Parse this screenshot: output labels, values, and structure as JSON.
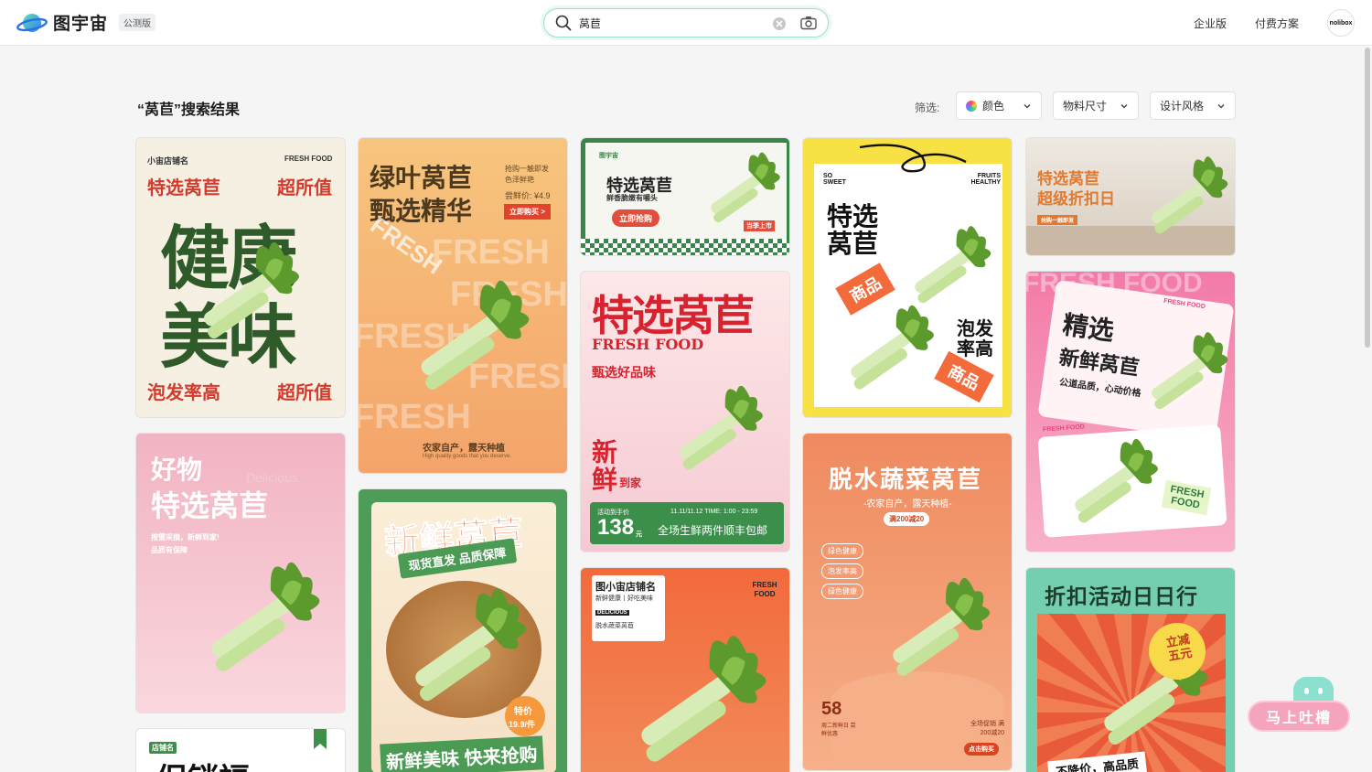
{
  "app": {
    "name": "图宇宙",
    "badge": "公测版"
  },
  "search": {
    "value": "莴苣"
  },
  "nav": {
    "enterprise": "企业版",
    "pricing": "付费方案",
    "avatar_text": "nolibox"
  },
  "results": {
    "title": "“莴苣”搜索结果",
    "filter_label": "筛选:",
    "filters": [
      "颜色",
      "物料尺寸",
      "设计风格"
    ]
  },
  "cards": {
    "c1": {
      "shop": "小宙店铺名",
      "tag": "FRESH FOOD",
      "l1": "特选莴苣",
      "r1": "超所值",
      "big1": "健康",
      "big2": "美味",
      "l2": "泡发率高",
      "r2": "超所值"
    },
    "c2": {
      "title1": "绿叶莴苣",
      "title2": "甄选精华",
      "note1": "抢购一触即发",
      "note2": "色泽鲜艳",
      "price": "尝鲜价: ¥4.9",
      "btn": "立即购买 >",
      "bg": "FRESH",
      "bottom": "农家自产，露天种植",
      "sub": "High quality goods that you deserve."
    },
    "c3": {
      "brand": "图宇宙",
      "title": "特选莴苣",
      "sub": "鲜香脆嫩有嚼头",
      "btn": "立即抢购",
      "tag": "当季上市"
    },
    "c4": {
      "title": "特选莴苣",
      "sub": "FRESH FOOD",
      "tag": "甄选好品味",
      "v1": "新",
      "v2": "鲜",
      "v3": "到家",
      "promo": "活动到手价",
      "price": "138",
      "unit": "元",
      "time": "11.11/11.12  TIME: 1:00 - 23:59",
      "offer": "全场生鲜两件顺丰包邮"
    },
    "c5": {
      "so": "SO SWEET",
      "fruits": "FRUITS HEALTHY",
      "title1": "特选",
      "title2": "莴苣",
      "badge1": "商品",
      "side1": "泡发",
      "side2": "率高",
      "badge2": "商品"
    },
    "c6": {
      "title1": "特选莴苣",
      "title2": "超级折扣日",
      "btn": "抢购一触即发"
    },
    "c7": {
      "bg": "FRESH FOOD",
      "title1": "精选",
      "title2": "新鲜莴苣",
      "sub": "公道品质，心动价格",
      "fresh": "FRESH FOOD",
      "fresh_label": "FRESH FOOD"
    },
    "c8": {
      "title1": "好物",
      "title2": "特选莴苣",
      "deco": "Delicious",
      "sub1": "按需采摘，新鲜到家!",
      "sub2": "品质有保障"
    },
    "c9": {
      "title": "新鲜莴苣",
      "ribbon": "现货直发 品质保障",
      "price_label": "特价",
      "price": "19.9/件",
      "bottom": "新鲜美味  快来抢购"
    },
    "c10": {
      "shop": "图小宙店铺名",
      "tag": "新鲜健康丨好吃美味",
      "deli": "DELICIOUS",
      "sub": "脱水蔬菜莴苣",
      "fresh": "FRESH FOOD"
    },
    "c11": {
      "title": "脱水蔬菜莴苣",
      "sub": "-农家自产，露天种植-",
      "badge": "满200减20",
      "p1": "绿色健康",
      "p2": "泡发率高",
      "p3": "绿色健康",
      "price": "58",
      "price_note": "周二新鲜日 尝鲜优惠",
      "promo": "全场促销 满200减20",
      "btn": "点击购买"
    },
    "c12": {
      "title": "折扣活动日日行",
      "badge": "立减五元",
      "bottom": "不降价，高品质"
    },
    "c13": {
      "shop": "店铺名",
      "title": "促销福"
    }
  },
  "feedback": {
    "label": "马上吐槽"
  }
}
